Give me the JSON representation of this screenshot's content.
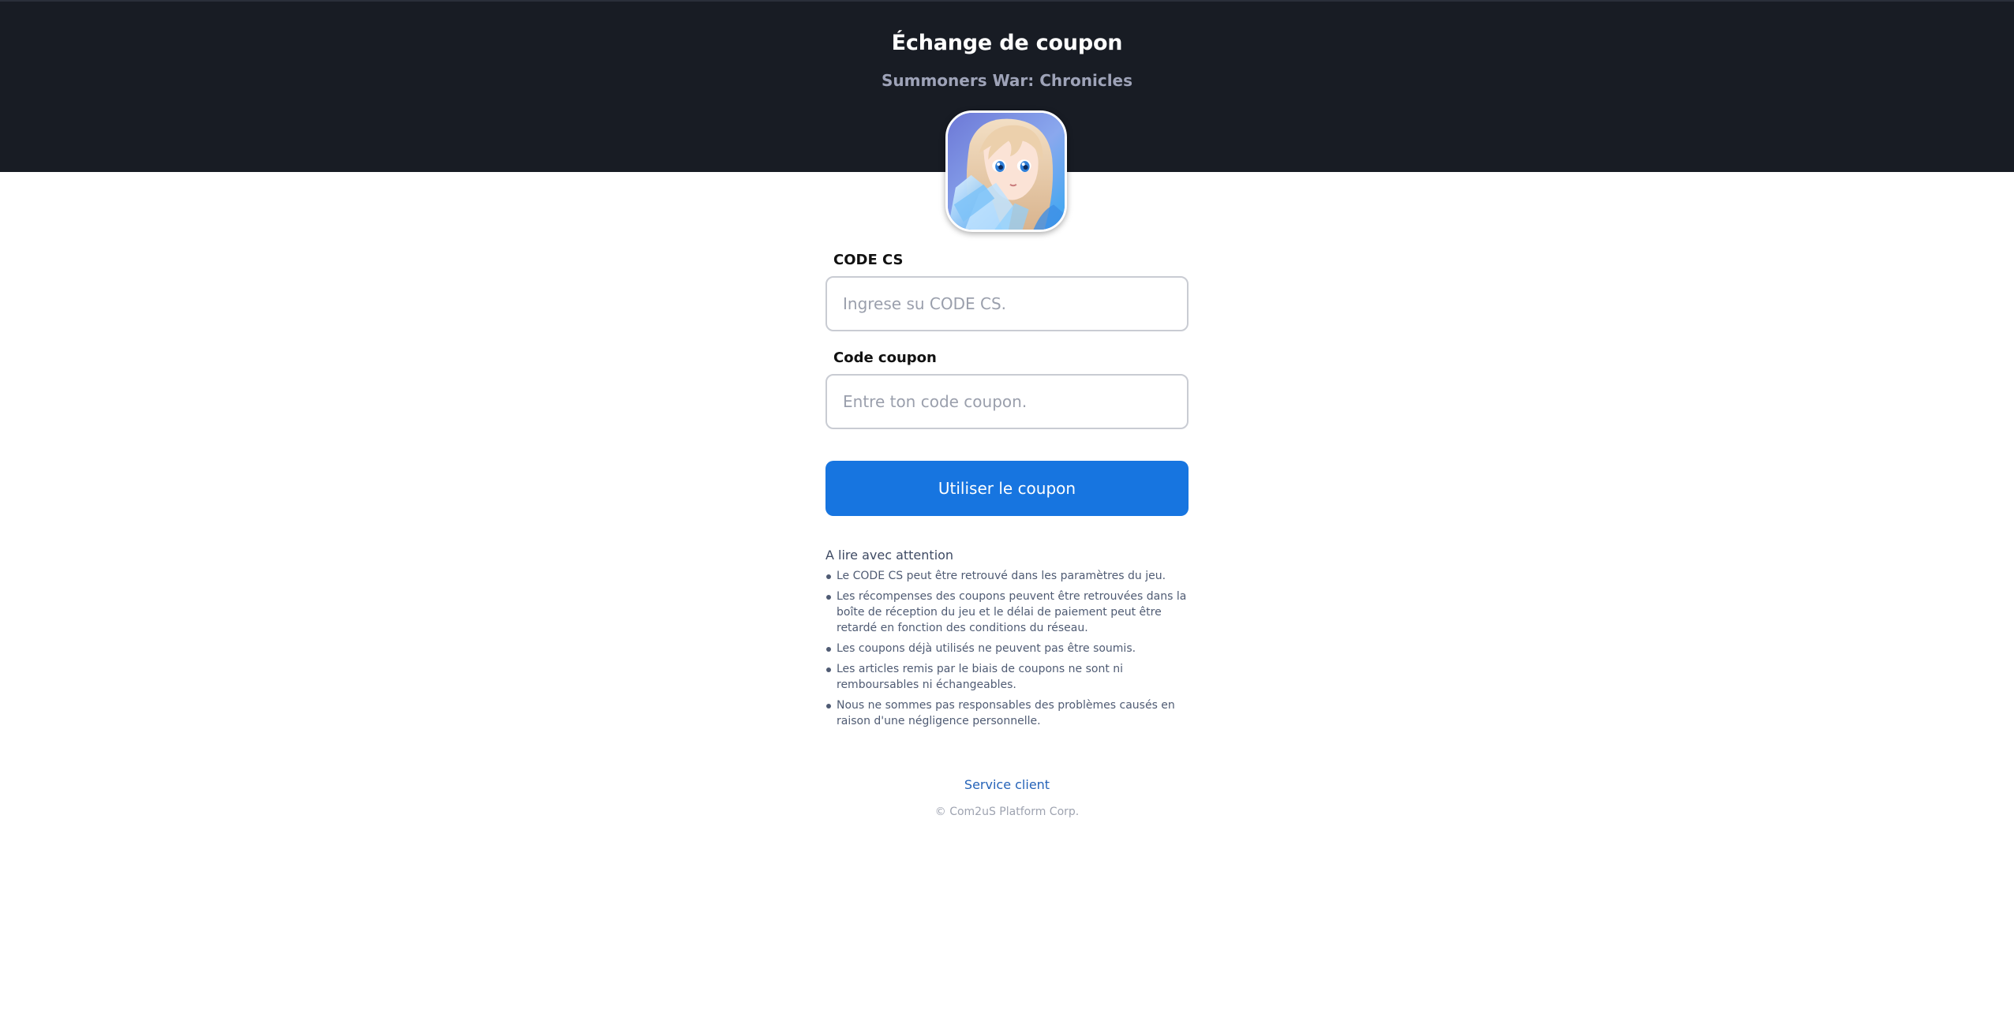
{
  "header": {
    "title": "Échange de coupon",
    "subtitle": "Summoners War: Chronicles",
    "background_color": "#181c24"
  },
  "game_icon": {
    "name": "game-icon"
  },
  "form": {
    "cs_code": {
      "label": "CODE CS",
      "placeholder": "Ingrese su CODE CS.",
      "value": ""
    },
    "coupon_code": {
      "label": "Code coupon",
      "placeholder": "Entre ton code coupon.",
      "value": ""
    },
    "submit_label": "Utiliser le coupon",
    "accent_color": "#1775e0"
  },
  "notice": {
    "title": "A lire avec attention",
    "items": [
      "Le CODE CS peut être retrouvé dans les paramètres du jeu.",
      "Les récompenses des coupons peuvent être retrouvées dans la boîte de réception du jeu et le délai de paiement peut être retardé en fonction des conditions du réseau.",
      "Les coupons déjà utilisés ne peuvent pas être soumis.",
      "Les articles remis par le biais de coupons ne sont ni remboursables ni échangeables.",
      "Nous ne sommes pas responsables des problèmes causés en raison d'une négligence personnelle."
    ]
  },
  "footer": {
    "support_link": "Service client",
    "copyright": "© Com2uS Platform Corp."
  }
}
